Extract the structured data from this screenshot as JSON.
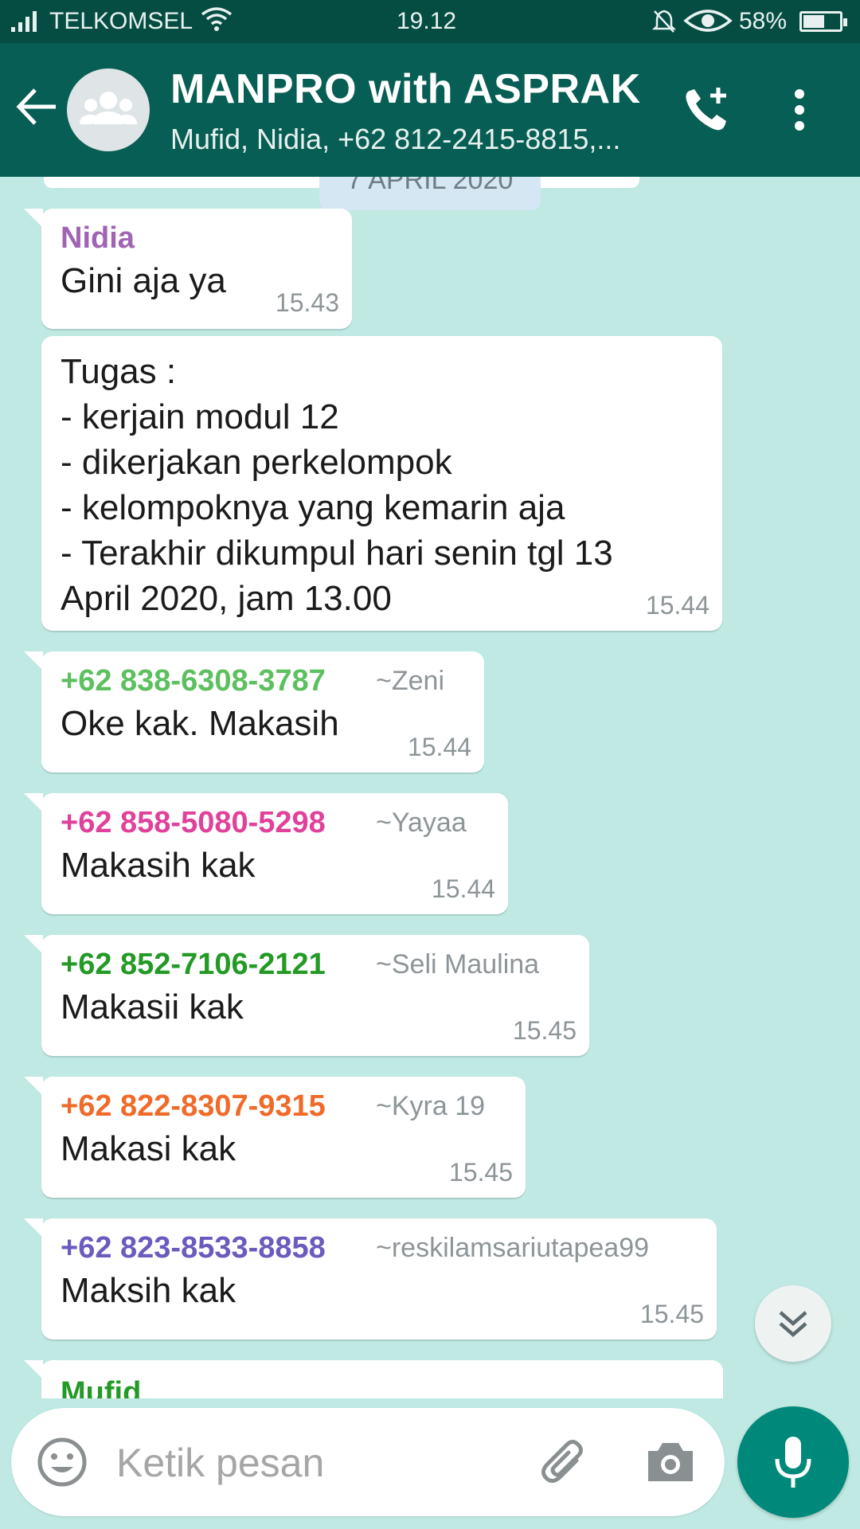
{
  "status_bar": {
    "carrier": "TELKOMSEL",
    "time": "19.12",
    "battery_percent": "58%",
    "battery_level": 0.58
  },
  "header": {
    "title": "MANPRO with ASPRAK",
    "subtitle": "Mufid, Nidia, +62 812-2415-8815,...",
    "icons": [
      "back-arrow-icon",
      "group-avatar-icon",
      "add-call-icon",
      "more-vert-icon"
    ]
  },
  "chat": {
    "date_chip": "7 APRIL 2020",
    "messages": [
      {
        "sender": "Nidia",
        "sender_color": "#a064b4",
        "alias": "",
        "text": "Gini aja ya",
        "time": "15.43"
      },
      {
        "sender": "",
        "sender_color": "",
        "alias": "",
        "text": "Tugas :\n- kerjain modul 12\n- dikerjakan perkelompok\n- kelompoknya yang kemarin aja\n- Terakhir dikumpul hari senin tgl 13\nApril 2020, jam 13.00",
        "time": "15.44"
      },
      {
        "sender": "+62 838-6308-3787",
        "sender_color": "#5cc05e",
        "alias": "~Zeni",
        "text": "Oke kak. Makasih",
        "time": "15.44"
      },
      {
        "sender": "+62 858-5080-5298",
        "sender_color": "#e0419b",
        "alias": "~Yayaa",
        "text": "Makasih kak",
        "time": "15.44"
      },
      {
        "sender": "+62 852-7106-2121",
        "sender_color": "#239a25",
        "alias": "~Seli Maulina",
        "text": "Makasii kak",
        "time": "15.45"
      },
      {
        "sender": "+62 822-8307-9315",
        "sender_color": "#f06b2a",
        "alias": "~Kyra 19",
        "text": "Makasi kak",
        "time": "15.45"
      },
      {
        "sender": "+62 823-8533-8858",
        "sender_color": "#6b5bbf",
        "alias": "~reskilamsariutapea99",
        "text": "Maksih kak",
        "time": "15.45"
      },
      {
        "sender": "Mufid",
        "sender_color": "#239a25",
        "alias": "",
        "text": "",
        "time": ""
      }
    ]
  },
  "input": {
    "placeholder": "Ketik pesan",
    "icons": [
      "emoji-icon",
      "attach-icon",
      "camera-icon",
      "mic-icon"
    ]
  },
  "colors": {
    "status_bar": "#054d43",
    "header": "#075e54",
    "chat_background": "#bfe9e2",
    "mic_button": "#00897b",
    "date_chip": "#d5e7f2"
  }
}
